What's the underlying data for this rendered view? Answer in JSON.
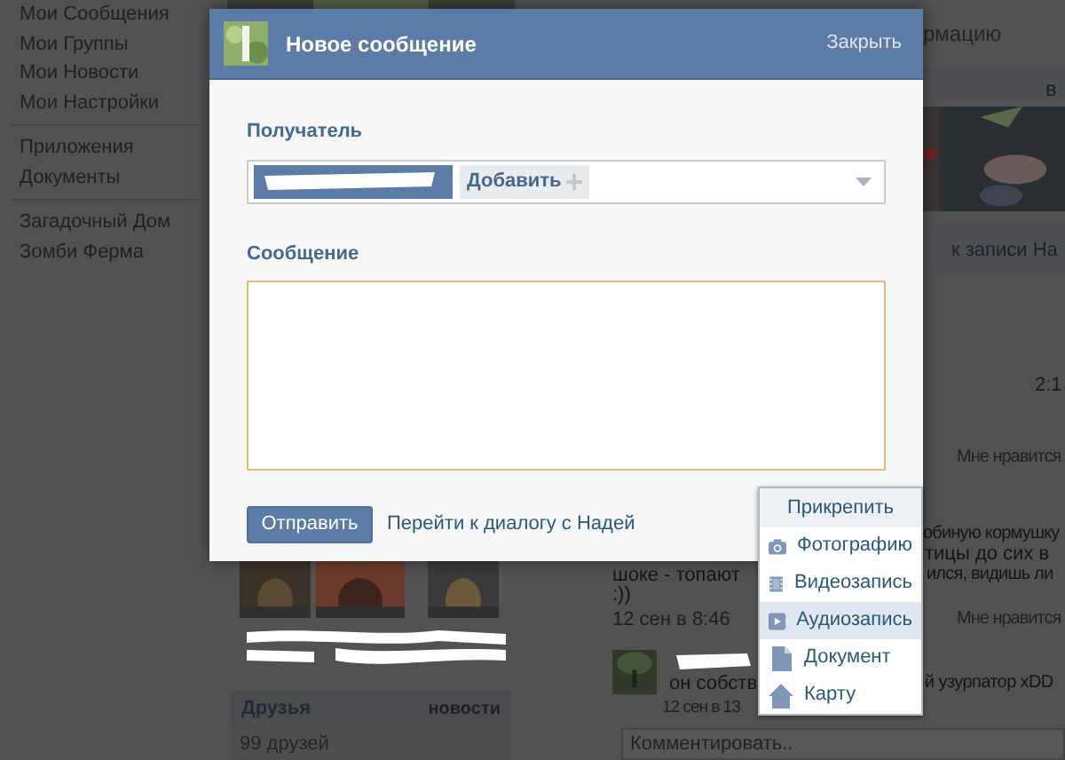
{
  "background_page": {
    "sidebar_groups": [
      [
        "Мои Сообщения",
        "Мои Группы",
        "Мои Новости",
        "Мои Настройки"
      ],
      [
        "Приложения",
        "Документы"
      ],
      [
        "Загадочный Дом",
        "Зомби Ферма"
      ]
    ],
    "friends": {
      "title": "Друзья",
      "link": "новости",
      "count": "99 друзей"
    },
    "feed": {
      "info_link": "рмацию",
      "header_link": "в",
      "wall_link": "к записи На",
      "post_time": "2:1",
      "post_like": "Мне нравится",
      "post_lines": [
        "обиную кормушку",
        "тицы до сих в",
        "шоке - топают",
        "ился, видишь ли",
        ":))"
      ],
      "post_date": "12 сен в 8:46",
      "post2_like": "Мне нравится",
      "comment_text": [
        "он собств",
        "й узурпатор xDD"
      ],
      "comment_date": "12 сен в 13",
      "comment_placeholder": "Комментировать.."
    }
  },
  "dialog": {
    "title": "Новое сообщение",
    "close": "Закрыть",
    "recipient_label": "Получатель",
    "add_button": "Добавить",
    "message_label": "Сообщение",
    "send_button": "Отправить",
    "dialog_link": "Перейти к диалогу с Надей"
  },
  "attach_menu": {
    "title": "Прикрепить",
    "items": [
      {
        "label": "Фотографию",
        "selected": false
      },
      {
        "kind": "video",
        "label": "Видеозапись",
        "selected": false
      },
      {
        "kind": "audio",
        "label": "Аудиозапись",
        "selected": true
      },
      {
        "kind": "document",
        "label": "Документ",
        "selected": false
      },
      {
        "kind": "map",
        "label": "Карту",
        "selected": false
      }
    ]
  }
}
